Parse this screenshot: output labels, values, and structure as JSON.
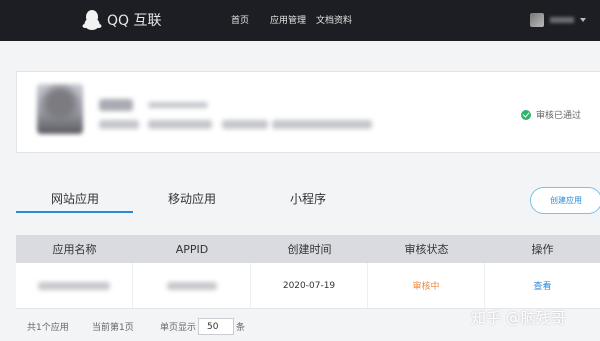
{
  "topbar": {
    "brand": "QQ 互联",
    "nav": {
      "home": "首页",
      "apps": "应用管理",
      "docs": "文档资料"
    }
  },
  "profile": {
    "verified_text": "审核已通过"
  },
  "tabs": {
    "website": "网站应用",
    "mobile": "移动应用",
    "mini": "小程序"
  },
  "actions": {
    "create": "创建应用"
  },
  "table": {
    "headers": [
      "应用名称",
      "APPID",
      "创建时间",
      "审核状态",
      "操作"
    ],
    "rows": [
      {
        "created": "2020-07-19",
        "status": "审核中",
        "action": "查看"
      }
    ]
  },
  "pagination": {
    "total": "共1个应用",
    "current": "当前第1页",
    "per_page_label": "单页显示",
    "per_page_value": "50",
    "unit": "条"
  },
  "watermark": "知乎 @脑残哥",
  "colors": {
    "accent": "#2b8ad8",
    "pending": "#f08a3c",
    "verified": "#2fb36d",
    "topbar": "#1c1e24"
  }
}
